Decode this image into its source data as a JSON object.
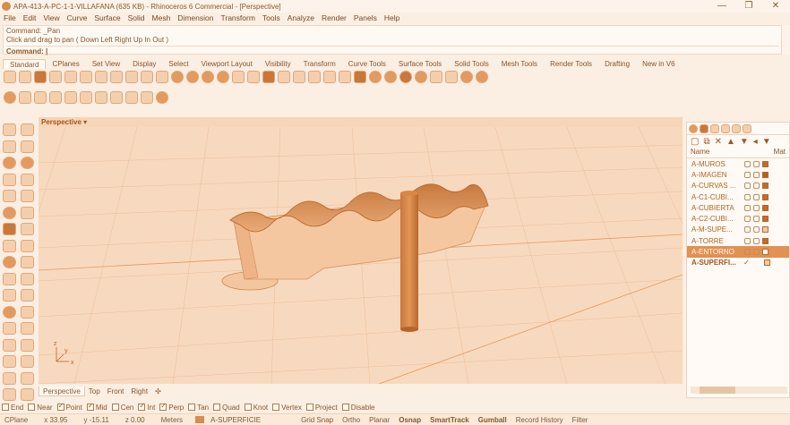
{
  "window": {
    "title": "APA-413-A-PC-1-1-VILLAFANA (635 KB) - Rhinoceros 6 Commercial - [Perspective]",
    "min": "—",
    "max": "❐",
    "close": "✕"
  },
  "menu": [
    "File",
    "Edit",
    "View",
    "Curve",
    "Surface",
    "Solid",
    "Mesh",
    "Dimension",
    "Transform",
    "Tools",
    "Analyze",
    "Render",
    "Panels",
    "Help"
  ],
  "command": {
    "history_1": "Command: _Pan",
    "history_2": "Click and drag to pan ( Down  Left  Right  Up  In  Out )",
    "prompt": "Command:"
  },
  "toolbar_tabs": [
    "Standard",
    "CPlanes",
    "Set View",
    "Display",
    "Select",
    "Viewport Layout",
    "Visibility",
    "Transform",
    "Curve Tools",
    "Surface Tools",
    "Solid Tools",
    "Mesh Tools",
    "Render Tools",
    "Drafting",
    "New in V6"
  ],
  "viewport": {
    "title": "Perspective",
    "dropdown": "▾"
  },
  "viewport_tabs": [
    "Perspective",
    "Top",
    "Front",
    "Right",
    "✣"
  ],
  "layers": {
    "header_name": "Name",
    "header_mat": "Mat",
    "items": [
      {
        "name": "A-MUROS",
        "color": "#c46a2a"
      },
      {
        "name": "A-IMAGEN",
        "color": "#b95f22"
      },
      {
        "name": "A-CURVAS ...",
        "color": "#c46a2a"
      },
      {
        "name": "A-C1-CUBI...",
        "color": "#c46a2a"
      },
      {
        "name": "A-CUBIERTA",
        "color": "#c46a2a"
      },
      {
        "name": "A-C2-CUBI...",
        "color": "#c46a2a"
      },
      {
        "name": "A-M-SUPE...",
        "color": "#f4c9a3"
      },
      {
        "name": "A-TORRE",
        "color": "#c46a2a"
      },
      {
        "name": "A-ENTORNO",
        "color": "#ffffff"
      },
      {
        "name": "A-SUPERFI...",
        "color": "#f4c9a3"
      }
    ]
  },
  "osnap": [
    "End",
    "Near",
    "Point",
    "Mid",
    "Cen",
    "Int",
    "Perp",
    "Tan",
    "Quad",
    "Knot",
    "Vertex",
    "Project",
    "Disable"
  ],
  "osnap_checked": [
    false,
    false,
    true,
    true,
    false,
    true,
    true,
    false,
    false,
    false,
    false,
    false,
    false
  ],
  "status": {
    "cplane": "CPlane",
    "x": "x 33.95",
    "y": "y -15.11",
    "z": "z 0.00",
    "units": "Meters",
    "layer": "A-SUPERFICIE",
    "grid_snap": "Grid Snap",
    "ortho": "Ortho",
    "planar": "Planar",
    "osnap": "Osnap",
    "smarttrack": "SmartTrack",
    "gumball": "Gumball",
    "record_history": "Record History",
    "filter": "Filter"
  },
  "axis": {
    "x": "x",
    "y": "y",
    "z": "z"
  }
}
